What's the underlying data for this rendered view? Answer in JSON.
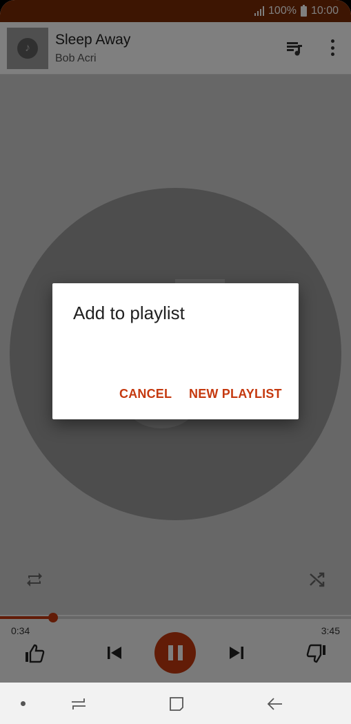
{
  "status_bar": {
    "battery": "100%",
    "time": "10:00"
  },
  "now_playing": {
    "title": "Sleep Away",
    "artist": "Bob Acri"
  },
  "header": {
    "queue_icon": "queue-music-icon",
    "more_icon": "more-vert-icon"
  },
  "playback": {
    "elapsed": "0:34",
    "duration": "3:45",
    "progress_fraction": 0.151,
    "state": "playing"
  },
  "controls": {
    "icons": [
      "repeat-icon",
      "shuffle-icon",
      "thumbs-up-icon",
      "skip-previous-icon",
      "pause-icon",
      "skip-next-icon",
      "thumbs-down-icon"
    ]
  },
  "dialog": {
    "title": "Add to playlist",
    "cancel_label": "CANCEL",
    "new_playlist_label": "NEW PLAYLIST"
  },
  "nav_bar": {
    "icons": [
      "dot-icon",
      "recent-apps-icon",
      "home-icon",
      "back-icon"
    ]
  },
  "colors": {
    "accent": "#c5390f",
    "status_bar": "#7a2a04"
  }
}
